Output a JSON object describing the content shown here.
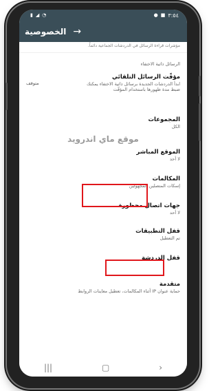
{
  "status_bar": {
    "time": "٣:٥٤",
    "battery_icon": "battery-icon",
    "signal_icon": "signal-icon",
    "wifi_icon": "wifi-icon"
  },
  "appbar": {
    "title": "الخصوصية",
    "back_icon": "arrow-right-icon"
  },
  "read_receipts_note": "مؤشرات قراءة الرسائل في الدردشات الجماعية دائماً.",
  "disappearing": {
    "section_title": "الرسائل ذاتية الاختفاء",
    "label": "مؤقّت الرسائل التلقائي",
    "description": "ابدأ الدردشات الجديدة برسائل ذاتية الاختفاء يمكنك ضبط مدة ظهورها باستخدام المؤقّت",
    "status": "متوقف"
  },
  "groups": {
    "label": "المجموعات",
    "value": "الكل"
  },
  "watermark": "موقع ماي اندرويد",
  "live_location": {
    "label": "الموقع المباشر",
    "value": "لا أحد"
  },
  "calls": {
    "label": "المكالمات",
    "value": "إسكات المتصلين المجهولين"
  },
  "blocked": {
    "label": "جهات اتصال محظورة",
    "value": "لا أحد"
  },
  "app_lock": {
    "label": "قفل التطبيقات",
    "value": "تم التعطيل"
  },
  "chat_lock": {
    "label": "قفل الدردشة"
  },
  "advanced": {
    "label": "متقدمة",
    "value": "حماية عنوان IP أثناء المكالمات، تعطيل معاينات الروابط"
  },
  "navbar": {
    "recent_icon": "recent-apps-icon",
    "home_icon": "home-icon",
    "back_icon": "back-icon"
  },
  "colors": {
    "appbar": "#3a4e58",
    "highlight": "#e0161b"
  }
}
